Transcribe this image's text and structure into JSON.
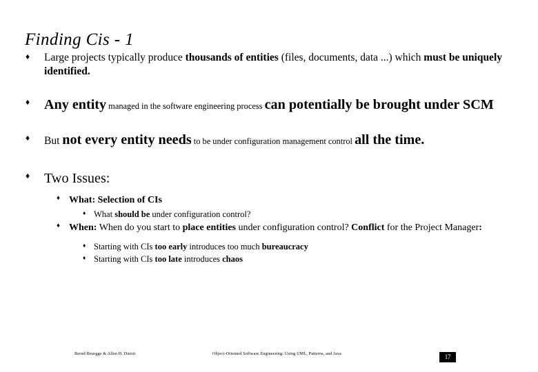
{
  "slide": {
    "title": "Finding Cis - 1",
    "bullet_glyph_level1": "♦",
    "bullet_glyph_level2": "♦",
    "bullet_glyph_level3": "♦"
  },
  "bullets": {
    "b1": {
      "run1": "Large projects typically produce ",
      "run2": "thousands of entities",
      "run3": " (files, documents, data ...) which ",
      "run4": "must be uniquely identified",
      "run5": "."
    },
    "b2": {
      "run1": "Any entity",
      "run2": " managed in the software engineering process ",
      "run3": "can potentially be brought under SCM"
    },
    "b3": {
      "run1": "But ",
      "run2": "not every entity needs",
      "run3": " to be under configuration management control ",
      "run4": "all the time."
    },
    "b4": {
      "run1": "Two Issues:"
    }
  },
  "sub_bullets": {
    "what": {
      "run1": "What: Selection of CIs"
    },
    "what_detail": {
      "run1": "What ",
      "run2": "should be",
      "run3": " under configuration control?"
    },
    "when": {
      "run1": "When:",
      "run2": " When do you start to ",
      "run3": "place entities",
      "run4": " under configuration control? ",
      "run5": "Conflict",
      "run6": " for the Project Manager",
      "run7": ":"
    },
    "too_early": {
      "run1": "Starting with CIs ",
      "run2": "too early",
      "run3": " introduces too much ",
      "run4": "bureaucracy"
    },
    "too_late": {
      "run1": "Starting with CIs ",
      "run2": "too late",
      "run3": " introduces ",
      "run4": "chaos"
    }
  },
  "footer": {
    "authors": "Bernd Bruegge & Allen H. Dutoit",
    "book_title": "Object-Oriented Software Engineering: Using UML, Patterns, and Java",
    "page_number": "17"
  }
}
